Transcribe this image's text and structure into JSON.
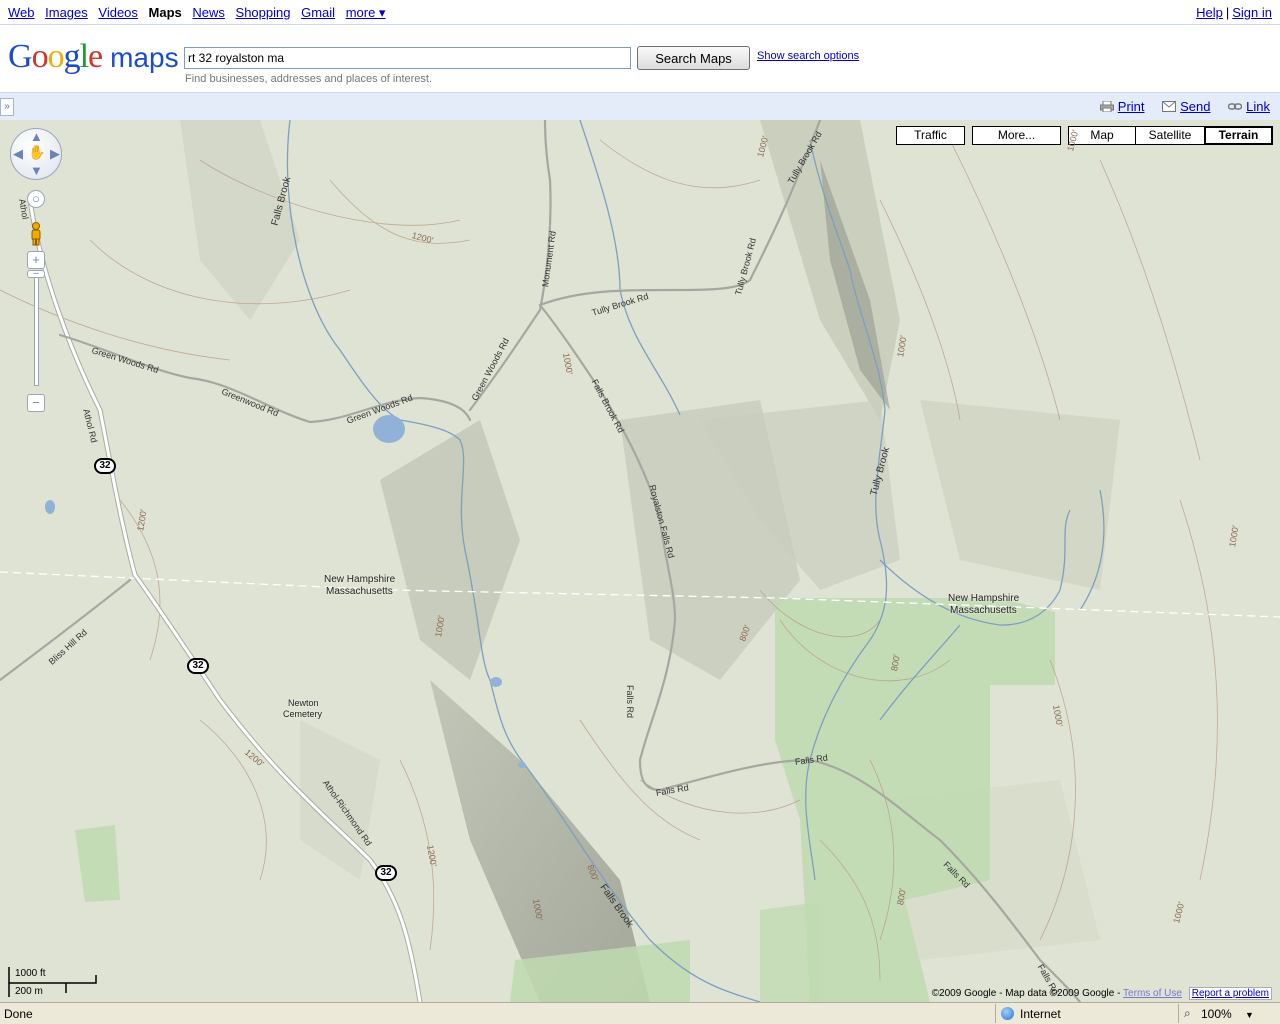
{
  "nav": {
    "items": [
      "Web",
      "Images",
      "Videos",
      "Maps",
      "News",
      "Shopping",
      "Gmail",
      "more ▾"
    ],
    "help": "Help",
    "signin": "Sign in"
  },
  "header": {
    "logo_letters": [
      "G",
      "o",
      "o",
      "g",
      "l",
      "e"
    ],
    "logo_maps": "maps",
    "search_value": "rt 32 royalston ma",
    "search_button": "Search Maps",
    "search_options": "Show search options",
    "hint": "Find businesses, addresses and places of interest."
  },
  "toolbar": {
    "collapse": "»",
    "print": "Print",
    "send": "Send",
    "link": "Link"
  },
  "map": {
    "buttons": {
      "traffic": "Traffic",
      "more": "More...",
      "map": "Map",
      "satellite": "Satellite",
      "terrain": "Terrain",
      "selected": "Terrain"
    },
    "labels": {
      "nh1": "New Hampshire",
      "ma1": "Massachusetts",
      "nh2": "New Hampshire",
      "ma2": "Massachusetts",
      "cemetery1": "Newton",
      "cemetery2": "Cemetery"
    },
    "roads": {
      "falls_brook_top": "Falls Brook",
      "tully_brook_rd_ne": "Tully Brook Rd",
      "tully_brook_rd": "Tully Brook Rd",
      "tully_brook_rd_mid": "Tully Brook Rd",
      "monument_rd": "Monument Rd",
      "green_woods_rd_w": "Green Woods Rd",
      "greenwood_rd": "Greenwood Rd",
      "green_woods_rd_e": "Green Woods Rd",
      "green_woods_rd_n": "Green Woods Rd",
      "falls_brook_rd": "Falls Brook Rd",
      "royalston_falls_rd": "Royalston Falls Rd",
      "tully_brook": "Tully Brook",
      "athol_rd": "Athol Rd",
      "athol_top": "Athol",
      "bliss_hill_rd": "Bliss Hill Rd",
      "athol_richmond_rd": "Athol-Richmond Rd",
      "falls_rd_v": "Falls Rd",
      "falls_rd_1": "Falls Rd",
      "falls_rd_2": "Falls Rd",
      "falls_rd_3": "Falls Rd",
      "falls_rd_4": "Falls Rd",
      "falls_brook_bottom": "Falls Brook"
    },
    "contours": [
      "1200'",
      "1000'",
      "1000'",
      "1000'",
      "1000'",
      "1000'",
      "1200'",
      "1000'",
      "800'",
      "800'",
      "1000'",
      "1200'",
      "1200'",
      "800'",
      "1000'",
      "800'",
      "1000'"
    ],
    "shields": [
      "32",
      "32",
      "32"
    ],
    "scale": {
      "imperial": "1000 ft",
      "metric": "200 m"
    },
    "copyright": "©2009 Google - Map data ©2009 Google -",
    "terms": "Terms of Use",
    "report": "Report a problem"
  },
  "status": {
    "text": "Done",
    "zone": "Internet",
    "zoom": "100%"
  }
}
